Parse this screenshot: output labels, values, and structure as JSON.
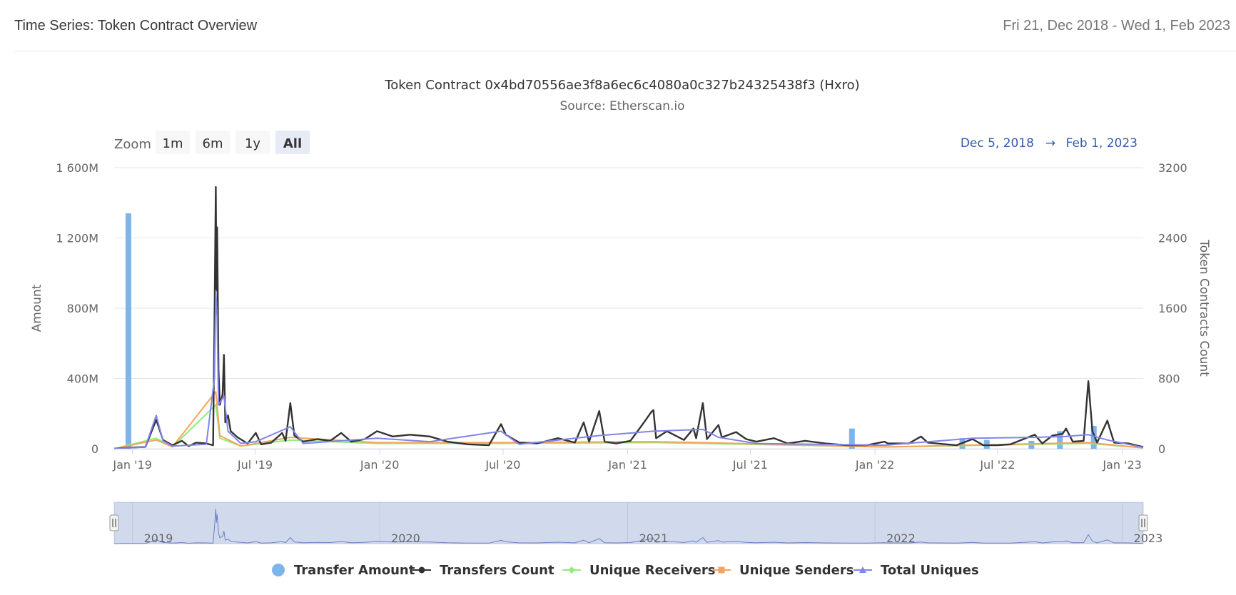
{
  "header": {
    "title": "Time Series: Token Contract Overview",
    "date_range": "Fri 21, Dec 2018 - Wed 1, Feb 2023"
  },
  "chart_data": {
    "type": "line",
    "title": "Token Contract 0x4bd70556ae3f8a6ec6c4080a0c327b24325438f3 (Hxro)",
    "subtitle": "Source: Etherscan.io",
    "zoom": {
      "label": "Zoom",
      "buttons": [
        "1m",
        "6m",
        "1y",
        "All"
      ],
      "selected": "All"
    },
    "range_selector": {
      "from": "Dec 5, 2018",
      "arrow": "→",
      "to": "Feb 1, 2023"
    },
    "x_axis": {
      "min": "2018-12-05",
      "max": "2023-02-01",
      "ticks": [
        {
          "date": "2019-01-01",
          "label": "Jan '19"
        },
        {
          "date": "2019-07-01",
          "label": "Jul '19"
        },
        {
          "date": "2020-01-01",
          "label": "Jan '20"
        },
        {
          "date": "2020-07-01",
          "label": "Jul '20"
        },
        {
          "date": "2021-01-01",
          "label": "Jan '21"
        },
        {
          "date": "2021-07-01",
          "label": "Jul '21"
        },
        {
          "date": "2022-01-01",
          "label": "Jan '22"
        },
        {
          "date": "2022-07-01",
          "label": "Jul '22"
        },
        {
          "date": "2023-01-01",
          "label": "Jan '23"
        }
      ]
    },
    "y_left": {
      "label": "Amount",
      "min": 0,
      "max": 1600000000,
      "ticks": [
        {
          "value": 0,
          "label": "0"
        },
        {
          "value": 400000000,
          "label": "400M"
        },
        {
          "value": 800000000,
          "label": "800M"
        },
        {
          "value": 1200000000,
          "label": "1 200M"
        },
        {
          "value": 1600000000,
          "label": "1 600M"
        }
      ]
    },
    "y_right": {
      "label": "Token Contracts Count",
      "min": 0,
      "max": 3200,
      "ticks": [
        {
          "value": 0,
          "label": "0"
        },
        {
          "value": 800,
          "label": "800"
        },
        {
          "value": 1600,
          "label": "1600"
        },
        {
          "value": 2400,
          "label": "2400"
        },
        {
          "value": 3200,
          "label": "3200"
        }
      ]
    },
    "grid": true,
    "legend_position": "bottom",
    "navigator": {
      "labels": [
        {
          "date": "2019-01-01",
          "label": "2019"
        },
        {
          "date": "2020-01-01",
          "label": "2020"
        },
        {
          "date": "2021-01-01",
          "label": "2021"
        },
        {
          "date": "2022-01-01",
          "label": "2022"
        },
        {
          "date": "2023-01-01",
          "label": "2023"
        }
      ]
    },
    "series": [
      {
        "name": "Transfer Amount",
        "type": "column",
        "axis": "left",
        "color": "#7cb5ec",
        "marker": "circle",
        "points": [
          [
            "2018-12-26",
            1340000000
          ],
          [
            "2021-11-28",
            115000000
          ],
          [
            "2022-05-10",
            60000000
          ],
          [
            "2022-06-15",
            50000000
          ],
          [
            "2022-08-20",
            45000000
          ],
          [
            "2022-10-01",
            100000000
          ],
          [
            "2022-11-20",
            130000000
          ]
        ]
      },
      {
        "name": "Transfers Count",
        "type": "line",
        "axis": "right",
        "color": "#333333",
        "marker": "circle",
        "points": [
          [
            "2018-12-05",
            0
          ],
          [
            "2018-12-21",
            10
          ],
          [
            "2019-01-01",
            15
          ],
          [
            "2019-01-20",
            20
          ],
          [
            "2019-02-05",
            330
          ],
          [
            "2019-02-15",
            100
          ],
          [
            "2019-03-01",
            40
          ],
          [
            "2019-03-15",
            90
          ],
          [
            "2019-03-25",
            30
          ],
          [
            "2019-04-05",
            70
          ],
          [
            "2019-04-20",
            60
          ],
          [
            "2019-04-30",
            40
          ],
          [
            "2019-05-02",
            1400
          ],
          [
            "2019-05-04",
            2980
          ],
          [
            "2019-05-05",
            1800
          ],
          [
            "2019-05-06",
            2520
          ],
          [
            "2019-05-08",
            900
          ],
          [
            "2019-05-10",
            500
          ],
          [
            "2019-05-14",
            620
          ],
          [
            "2019-05-16",
            1070
          ],
          [
            "2019-05-18",
            300
          ],
          [
            "2019-05-22",
            380
          ],
          [
            "2019-05-26",
            200
          ],
          [
            "2019-06-05",
            130
          ],
          [
            "2019-06-20",
            60
          ],
          [
            "2019-07-02",
            180
          ],
          [
            "2019-07-10",
            50
          ],
          [
            "2019-07-25",
            70
          ],
          [
            "2019-08-10",
            180
          ],
          [
            "2019-08-15",
            90
          ],
          [
            "2019-08-22",
            520
          ],
          [
            "2019-08-28",
            150
          ],
          [
            "2019-09-10",
            80
          ],
          [
            "2019-10-01",
            110
          ],
          [
            "2019-10-20",
            90
          ],
          [
            "2019-11-05",
            180
          ],
          [
            "2019-11-20",
            80
          ],
          [
            "2019-12-10",
            110
          ],
          [
            "2019-12-28",
            200
          ],
          [
            "2020-01-20",
            140
          ],
          [
            "2020-02-15",
            160
          ],
          [
            "2020-03-15",
            140
          ],
          [
            "2020-04-10",
            80
          ],
          [
            "2020-05-10",
            50
          ],
          [
            "2020-06-10",
            40
          ],
          [
            "2020-06-28",
            280
          ],
          [
            "2020-07-05",
            160
          ],
          [
            "2020-07-25",
            70
          ],
          [
            "2020-08-20",
            60
          ],
          [
            "2020-09-20",
            120
          ],
          [
            "2020-10-15",
            70
          ],
          [
            "2020-10-28",
            300
          ],
          [
            "2020-11-05",
            80
          ],
          [
            "2020-11-20",
            430
          ],
          [
            "2020-11-28",
            80
          ],
          [
            "2020-12-15",
            60
          ],
          [
            "2021-01-05",
            90
          ],
          [
            "2021-01-25",
            300
          ],
          [
            "2021-02-05",
            420
          ],
          [
            "2021-02-08",
            440
          ],
          [
            "2021-02-12",
            120
          ],
          [
            "2021-02-28",
            200
          ],
          [
            "2021-03-10",
            160
          ],
          [
            "2021-03-25",
            100
          ],
          [
            "2021-04-08",
            230
          ],
          [
            "2021-04-12",
            120
          ],
          [
            "2021-04-22",
            520
          ],
          [
            "2021-04-28",
            110
          ],
          [
            "2021-05-15",
            270
          ],
          [
            "2021-05-20",
            130
          ],
          [
            "2021-06-10",
            190
          ],
          [
            "2021-06-25",
            110
          ],
          [
            "2021-07-10",
            80
          ],
          [
            "2021-08-05",
            120
          ],
          [
            "2021-08-25",
            60
          ],
          [
            "2021-09-20",
            90
          ],
          [
            "2021-10-20",
            60
          ],
          [
            "2021-11-20",
            40
          ],
          [
            "2021-12-20",
            40
          ],
          [
            "2022-01-15",
            80
          ],
          [
            "2022-01-20",
            60
          ],
          [
            "2022-02-20",
            60
          ],
          [
            "2022-03-10",
            140
          ],
          [
            "2022-03-20",
            70
          ],
          [
            "2022-05-01",
            40
          ],
          [
            "2022-05-25",
            110
          ],
          [
            "2022-06-10",
            40
          ],
          [
            "2022-07-01",
            40
          ],
          [
            "2022-07-20",
            50
          ],
          [
            "2022-08-25",
            160
          ],
          [
            "2022-09-05",
            60
          ],
          [
            "2022-09-20",
            150
          ],
          [
            "2022-10-05",
            170
          ],
          [
            "2022-10-10",
            230
          ],
          [
            "2022-10-20",
            80
          ],
          [
            "2022-11-05",
            90
          ],
          [
            "2022-11-12",
            770
          ],
          [
            "2022-11-18",
            200
          ],
          [
            "2022-11-25",
            70
          ],
          [
            "2022-12-10",
            320
          ],
          [
            "2022-12-20",
            70
          ],
          [
            "2023-01-10",
            60
          ],
          [
            "2023-02-01",
            20
          ]
        ]
      },
      {
        "name": "Unique Receivers",
        "type": "line",
        "axis": "right",
        "color": "#90ed7d",
        "marker": "diamond",
        "points": [
          [
            "2018-12-05",
            0
          ],
          [
            "2019-02-05",
            120
          ],
          [
            "2019-03-01",
            20
          ],
          [
            "2019-05-04",
            500
          ],
          [
            "2019-05-10",
            120
          ],
          [
            "2019-06-10",
            30
          ],
          [
            "2019-08-22",
            100
          ],
          [
            "2019-12-28",
            60
          ],
          [
            "2020-06-28",
            60
          ],
          [
            "2021-02-08",
            70
          ],
          [
            "2021-04-22",
            60
          ],
          [
            "2022-01-15",
            20
          ],
          [
            "2022-11-12",
            60
          ],
          [
            "2023-02-01",
            10
          ]
        ]
      },
      {
        "name": "Unique Senders",
        "type": "line",
        "axis": "right",
        "color": "#f7a35c",
        "marker": "square",
        "points": [
          [
            "2018-12-05",
            0
          ],
          [
            "2019-02-05",
            100
          ],
          [
            "2019-03-01",
            20
          ],
          [
            "2019-05-04",
            650
          ],
          [
            "2019-05-10",
            150
          ],
          [
            "2019-06-10",
            30
          ],
          [
            "2019-08-22",
            130
          ],
          [
            "2019-12-28",
            70
          ],
          [
            "2020-06-28",
            70
          ],
          [
            "2021-02-08",
            80
          ],
          [
            "2021-04-22",
            70
          ],
          [
            "2022-01-15",
            20
          ],
          [
            "2022-11-12",
            70
          ],
          [
            "2023-02-01",
            10
          ]
        ]
      },
      {
        "name": "Total Uniques",
        "type": "line",
        "axis": "right",
        "color": "#8085e9",
        "marker": "triangle",
        "points": [
          [
            "2018-12-05",
            0
          ],
          [
            "2019-01-20",
            20
          ],
          [
            "2019-02-05",
            380
          ],
          [
            "2019-02-15",
            90
          ],
          [
            "2019-03-01",
            30
          ],
          [
            "2019-04-20",
            50
          ],
          [
            "2019-05-02",
            800
          ],
          [
            "2019-05-04",
            1800
          ],
          [
            "2019-05-06",
            1500
          ],
          [
            "2019-05-08",
            500
          ],
          [
            "2019-05-16",
            600
          ],
          [
            "2019-05-22",
            200
          ],
          [
            "2019-06-10",
            60
          ],
          [
            "2019-07-02",
            80
          ],
          [
            "2019-08-22",
            250
          ],
          [
            "2019-09-10",
            60
          ],
          [
            "2019-12-28",
            120
          ],
          [
            "2020-03-15",
            80
          ],
          [
            "2020-06-28",
            200
          ],
          [
            "2020-07-25",
            50
          ],
          [
            "2020-11-20",
            150
          ],
          [
            "2021-02-08",
            200
          ],
          [
            "2021-04-22",
            220
          ],
          [
            "2021-05-15",
            130
          ],
          [
            "2021-07-10",
            60
          ],
          [
            "2022-01-15",
            40
          ],
          [
            "2022-05-25",
            120
          ],
          [
            "2022-08-25",
            130
          ],
          [
            "2022-10-10",
            140
          ],
          [
            "2022-11-12",
            160
          ],
          [
            "2022-12-10",
            100
          ],
          [
            "2023-02-01",
            15
          ]
        ]
      }
    ]
  }
}
